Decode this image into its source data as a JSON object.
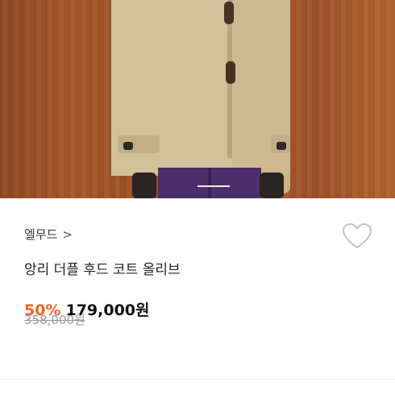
{
  "product": {
    "brand": "엘무드",
    "brand_chevron": ">",
    "title": "앙리 더플 후드 코트 올리브",
    "discount": "50%",
    "sale_price": "179,000원",
    "original_price": "358,000원"
  },
  "colors": {
    "discount": "#f2641f",
    "text": "#222222",
    "muted": "#9a9a9a"
  },
  "icons": {
    "like": "heart-outline-icon"
  }
}
